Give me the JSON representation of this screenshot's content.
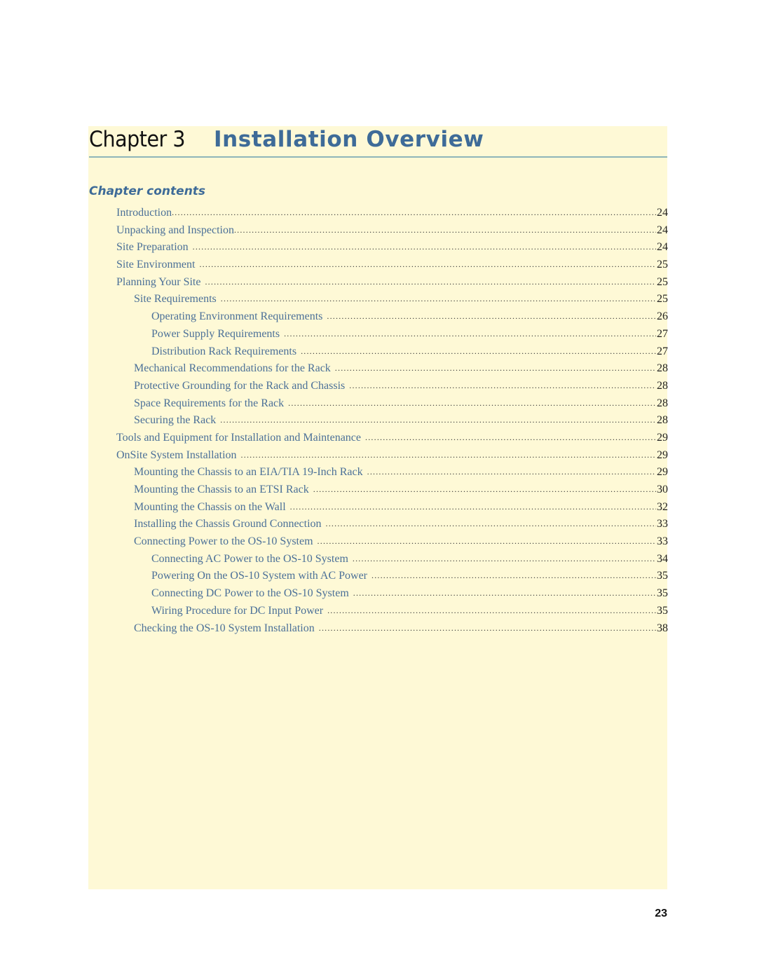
{
  "chapter": {
    "label": "Chapter 3",
    "title": "Installation Overview"
  },
  "contents_heading": "Chapter contents",
  "toc": [
    {
      "title": "Introduction",
      "page": "24",
      "level": 1
    },
    {
      "title": "Unpacking and Inspection",
      "page": "24",
      "level": 1
    },
    {
      "title": "Site Preparation",
      "page": "24",
      "level": 1
    },
    {
      "title": "Site Environment",
      "page": "25",
      "level": 1
    },
    {
      "title": "Planning Your Site",
      "page": "25",
      "level": 1
    },
    {
      "title": "Site Requirements",
      "page": "25",
      "level": 2
    },
    {
      "title": "Operating Environment Requirements",
      "page": "26",
      "level": 3
    },
    {
      "title": "Power Supply Requirements",
      "page": "27",
      "level": 3
    },
    {
      "title": "Distribution Rack Requirements",
      "page": "27",
      "level": 3
    },
    {
      "title": "Mechanical Recommendations for the Rack",
      "page": "28",
      "level": 2
    },
    {
      "title": "Protective Grounding for the Rack and Chassis",
      "page": "28",
      "level": 2
    },
    {
      "title": "Space Requirements for the Rack",
      "page": "28",
      "level": 2
    },
    {
      "title": "Securing the Rack",
      "page": "28",
      "level": 2
    },
    {
      "title": "Tools and Equipment for Installation and Maintenance",
      "page": "29",
      "level": 1
    },
    {
      "title": "OnSite System Installation",
      "page": "29",
      "level": 1
    },
    {
      "title": "Mounting the Chassis to an EIA/TIA 19-Inch Rack",
      "page": "29",
      "level": 2
    },
    {
      "title": "Mounting the Chassis to an ETSI Rack",
      "page": "30",
      "level": 2
    },
    {
      "title": "Mounting the Chassis on the Wall",
      "page": "32",
      "level": 2
    },
    {
      "title": "Installing the Chassis Ground Connection",
      "page": "33",
      "level": 2
    },
    {
      "title": "Connecting Power to the OS-10 System",
      "page": "33",
      "level": 2
    },
    {
      "title": "Connecting AC Power to the OS-10 System",
      "page": "34",
      "level": 3
    },
    {
      "title": "Powering On the OS-10 System with AC Power",
      "page": "35",
      "level": 3
    },
    {
      "title": "Connecting DC Power to the OS-10 System",
      "page": "35",
      "level": 3
    },
    {
      "title": "Wiring Procedure for DC Input Power",
      "page": "35",
      "level": 3
    },
    {
      "title": "Checking the OS-10 System Installation",
      "page": "38",
      "level": 2
    }
  ],
  "page_number": "23",
  "colors": {
    "panel_background": "#fef9d6",
    "title_blue": "#3e6b98",
    "toc_text": "#4b7098",
    "rule": "#8fb5b9"
  }
}
